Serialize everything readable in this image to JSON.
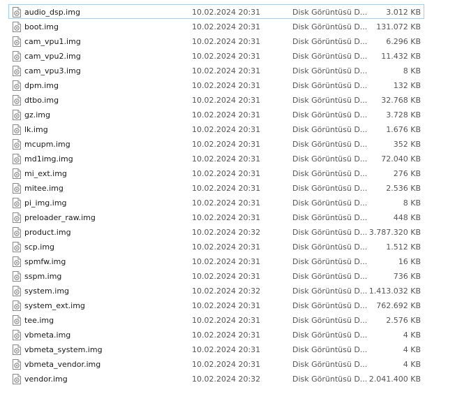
{
  "files": [
    {
      "name": "audio_dsp.img",
      "date": "10.02.2024 20:31",
      "type": "Disk Görüntüsü D...",
      "size": "3.012 KB",
      "selected": true
    },
    {
      "name": "boot.img",
      "date": "10.02.2024 20:31",
      "type": "Disk Görüntüsü D...",
      "size": "131.072 KB"
    },
    {
      "name": "cam_vpu1.img",
      "date": "10.02.2024 20:31",
      "type": "Disk Görüntüsü D...",
      "size": "6.296 KB"
    },
    {
      "name": "cam_vpu2.img",
      "date": "10.02.2024 20:31",
      "type": "Disk Görüntüsü D...",
      "size": "11.432 KB"
    },
    {
      "name": "cam_vpu3.img",
      "date": "10.02.2024 20:31",
      "type": "Disk Görüntüsü D...",
      "size": "8 KB"
    },
    {
      "name": "dpm.img",
      "date": "10.02.2024 20:31",
      "type": "Disk Görüntüsü D...",
      "size": "132 KB"
    },
    {
      "name": "dtbo.img",
      "date": "10.02.2024 20:31",
      "type": "Disk Görüntüsü D...",
      "size": "32.768 KB"
    },
    {
      "name": "gz.img",
      "date": "10.02.2024 20:31",
      "type": "Disk Görüntüsü D...",
      "size": "3.728 KB"
    },
    {
      "name": "lk.img",
      "date": "10.02.2024 20:31",
      "type": "Disk Görüntüsü D...",
      "size": "1.676 KB"
    },
    {
      "name": "mcupm.img",
      "date": "10.02.2024 20:31",
      "type": "Disk Görüntüsü D...",
      "size": "352 KB"
    },
    {
      "name": "md1img.img",
      "date": "10.02.2024 20:31",
      "type": "Disk Görüntüsü D...",
      "size": "72.040 KB"
    },
    {
      "name": "mi_ext.img",
      "date": "10.02.2024 20:31",
      "type": "Disk Görüntüsü D...",
      "size": "276 KB"
    },
    {
      "name": "mitee.img",
      "date": "10.02.2024 20:31",
      "type": "Disk Görüntüsü D...",
      "size": "2.536 KB"
    },
    {
      "name": "pi_img.img",
      "date": "10.02.2024 20:31",
      "type": "Disk Görüntüsü D...",
      "size": "8 KB"
    },
    {
      "name": "preloader_raw.img",
      "date": "10.02.2024 20:31",
      "type": "Disk Görüntüsü D...",
      "size": "448 KB"
    },
    {
      "name": "product.img",
      "date": "10.02.2024 20:32",
      "type": "Disk Görüntüsü D...",
      "size": "3.787.320 KB"
    },
    {
      "name": "scp.img",
      "date": "10.02.2024 20:31",
      "type": "Disk Görüntüsü D...",
      "size": "1.512 KB"
    },
    {
      "name": "spmfw.img",
      "date": "10.02.2024 20:31",
      "type": "Disk Görüntüsü D...",
      "size": "16 KB"
    },
    {
      "name": "sspm.img",
      "date": "10.02.2024 20:31",
      "type": "Disk Görüntüsü D...",
      "size": "736 KB"
    },
    {
      "name": "system.img",
      "date": "10.02.2024 20:32",
      "type": "Disk Görüntüsü D...",
      "size": "1.413.032 KB"
    },
    {
      "name": "system_ext.img",
      "date": "10.02.2024 20:31",
      "type": "Disk Görüntüsü D...",
      "size": "762.692 KB"
    },
    {
      "name": "tee.img",
      "date": "10.02.2024 20:31",
      "type": "Disk Görüntüsü D...",
      "size": "2.576 KB"
    },
    {
      "name": "vbmeta.img",
      "date": "10.02.2024 20:31",
      "type": "Disk Görüntüsü D...",
      "size": "4 KB"
    },
    {
      "name": "vbmeta_system.img",
      "date": "10.02.2024 20:31",
      "type": "Disk Görüntüsü D...",
      "size": "4 KB"
    },
    {
      "name": "vbmeta_vendor.img",
      "date": "10.02.2024 20:31",
      "type": "Disk Görüntüsü D...",
      "size": "4 KB"
    },
    {
      "name": "vendor.img",
      "date": "10.02.2024 20:32",
      "type": "Disk Görüntüsü D...",
      "size": "2.041.400 KB"
    }
  ],
  "icon": "disk-image-file-icon",
  "colors": {
    "selection_border": "#99d1ff",
    "text": "#1a1a1a",
    "secondary_text": "#555555"
  }
}
